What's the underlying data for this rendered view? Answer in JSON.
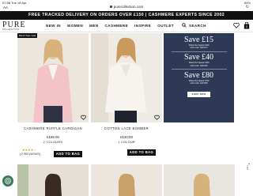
{
  "status": {
    "time": "07:58",
    "date": "Tue 18 Apr",
    "battery": "84%"
  },
  "browser": {
    "aa": "AA",
    "url": "purecollection.com"
  },
  "promo": {
    "text": "FREE TRACKED DELIVERY ON ORDERS OVER £150 | CASHMERE EXPERTS SINCE 2002"
  },
  "header": {
    "logo_main": "PURE",
    "logo_sub": "COLLECTION",
    "nav": [
      "NEW IN",
      "WOMEN",
      "MEN",
      "CASHMERE",
      "INSPIRE",
      "OUTLET"
    ],
    "search_label": "SEARCH",
    "bag_count": "0"
  },
  "products": [
    {
      "badge": "BESTSELLER",
      "name": "CASHMERE RUFFLE CARDIGAN",
      "price": "£169.00",
      "colours": "2 COLOURS",
      "stars": "★★★★☆",
      "reviews": "(2 REVIEWS)",
      "cta": "ADD TO BAG",
      "rating": 4
    },
    {
      "badge": "",
      "name": "COTTON LACE BOMBER",
      "price": "£120.00",
      "colours": "1 COLOUR",
      "cta": "ADD TO BAG"
    }
  ],
  "offer": {
    "tiers": [
      {
        "amount": "Save £15",
        "line1": "When You Spend £200",
        "line2": "with code: SAVE15"
      },
      {
        "amount": "Save £40",
        "line1": "When You Spend £400",
        "line2": "with code: SAVE40"
      },
      {
        "amount": "Save £80",
        "line1": "When You Spend £700",
        "line2": "with code: SAVE80"
      }
    ],
    "cta": "SHOP NOW"
  },
  "side": {
    "top_label": "TOP"
  },
  "colors": {
    "promo_bg": "#111111",
    "offer_bg": "#2e3a55",
    "cookie": "#3b7a5b"
  }
}
